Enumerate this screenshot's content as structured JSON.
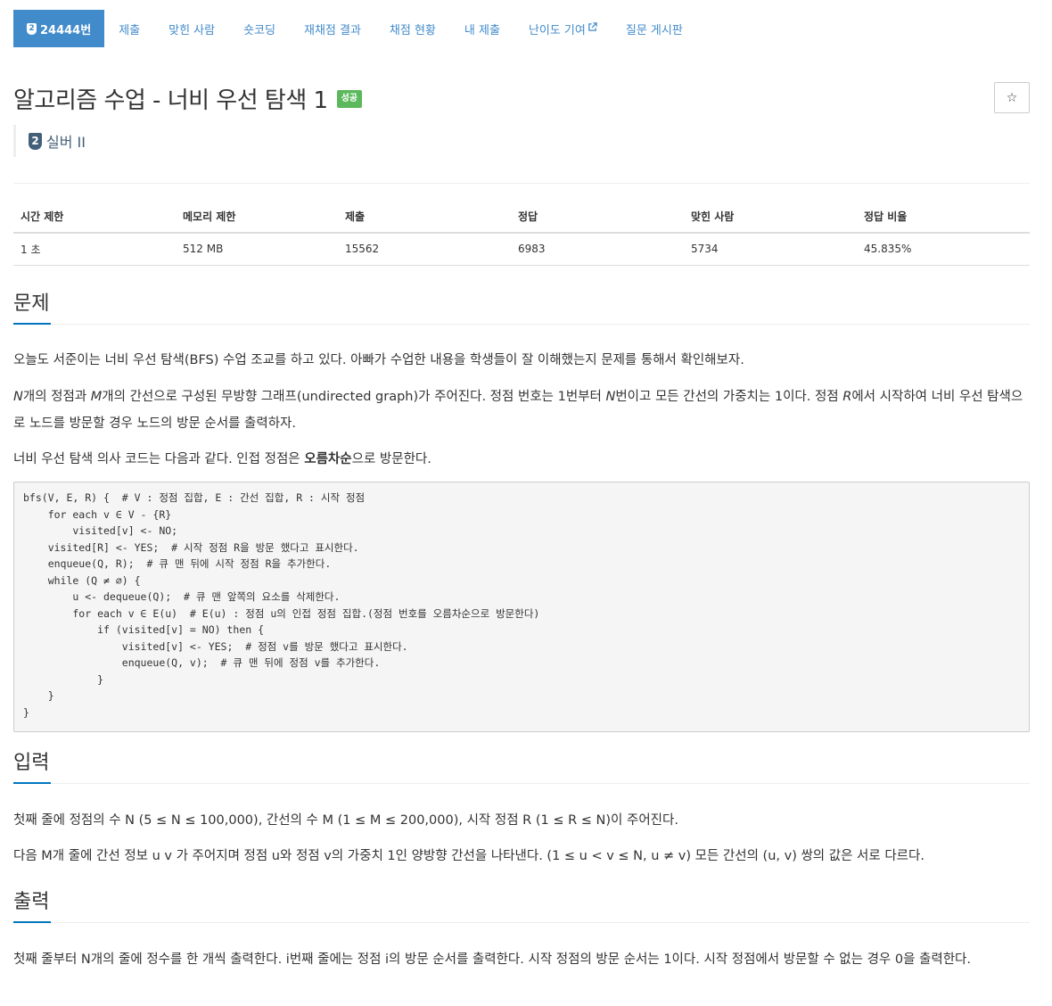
{
  "nav": {
    "problem_tier_digit": "2",
    "problem_id_label": "24444번",
    "items": [
      "제출",
      "맞힌 사람",
      "숏코딩",
      "재채점 결과",
      "채점 현황",
      "내 제출",
      "난이도 기여",
      "질문 게시판"
    ]
  },
  "problem": {
    "title": "알고리즘 수업 - 너비 우선 탐색 1",
    "status_badge": "성공",
    "star_symbol": "☆",
    "tier_digit": "2",
    "tier_label": "실버 II"
  },
  "stats": {
    "headers": [
      "시간 제한",
      "메모리 제한",
      "제출",
      "정답",
      "맞힌 사람",
      "정답 비율"
    ],
    "values": [
      "1 초",
      "512 MB",
      "15562",
      "6983",
      "5734",
      "45.835%"
    ]
  },
  "sections": {
    "problem": {
      "heading": "문제",
      "p1": "오늘도 서준이는 너비 우선 탐색(BFS) 수업 조교를 하고 있다. 아빠가 수업한 내용을 학생들이 잘 이해했는지 문제를 통해서 확인해보자.",
      "p2": {
        "a": "N",
        "b": "개의 정점과 ",
        "c": "M",
        "d": "개의 간선으로 구성된 무방향 그래프(undirected graph)가 주어진다. 정점 번호는 1번부터 ",
        "e": "N",
        "f": "번이고 모든 간선의 가중치는 1이다. 정점 ",
        "g": "R",
        "h": "에서 시작하여 너비 우선 탐색으로 노드를 방문할 경우 노드의 방문 순서를 출력하자."
      },
      "p3": {
        "a": "너비 우선 탐색 의사 코드는 다음과 같다. 인접 정점은 ",
        "b": "오름차순",
        "c": "으로 방문한다."
      },
      "code": "bfs(V, E, R) {  # V : 정점 집합, E : 간선 집합, R : 시작 정점\n    for each v ∈ V - {R}\n        visited[v] <- NO;\n    visited[R] <- YES;  # 시작 정점 R을 방문 했다고 표시한다.\n    enqueue(Q, R);  # 큐 맨 뒤에 시작 정점 R을 추가한다.\n    while (Q ≠ ∅) {\n        u <- dequeue(Q);  # 큐 맨 앞쪽의 요소를 삭제한다.\n        for each v ∈ E(u)  # E(u) : 정점 u의 인접 정점 집합.(정점 번호를 오름차순으로 방문한다)\n            if (visited[v] = NO) then {\n                visited[v] <- YES;  # 정점 v를 방문 했다고 표시한다.\n                enqueue(Q, v);  # 큐 맨 뒤에 정점 v를 추가한다.\n            }\n    }\n}"
    },
    "input": {
      "heading": "입력",
      "p1": "첫째 줄에 정점의 수 N (5 ≤ N ≤ 100,000), 간선의 수 M (1 ≤ M ≤ 200,000), 시작 정점 R (1 ≤ R ≤ N)이 주어진다.",
      "p2": "다음 M개 줄에 간선 정보  u  v 가 주어지며 정점 u와 정점 v의 가중치 1인 양방향 간선을 나타낸다. (1 ≤ u < v ≤ N, u ≠ v) 모든 간선의 (u, v) 쌍의 값은 서로 다르다."
    },
    "output": {
      "heading": "출력",
      "p1": "첫째 줄부터 N개의 줄에 정수를 한 개씩 출력한다. i번째 줄에는 정점 i의 방문 순서를 출력한다. 시작 정점의 방문 순서는 1이다. 시작 정점에서 방문할 수 없는 경우 0을 출력한다."
    }
  }
}
